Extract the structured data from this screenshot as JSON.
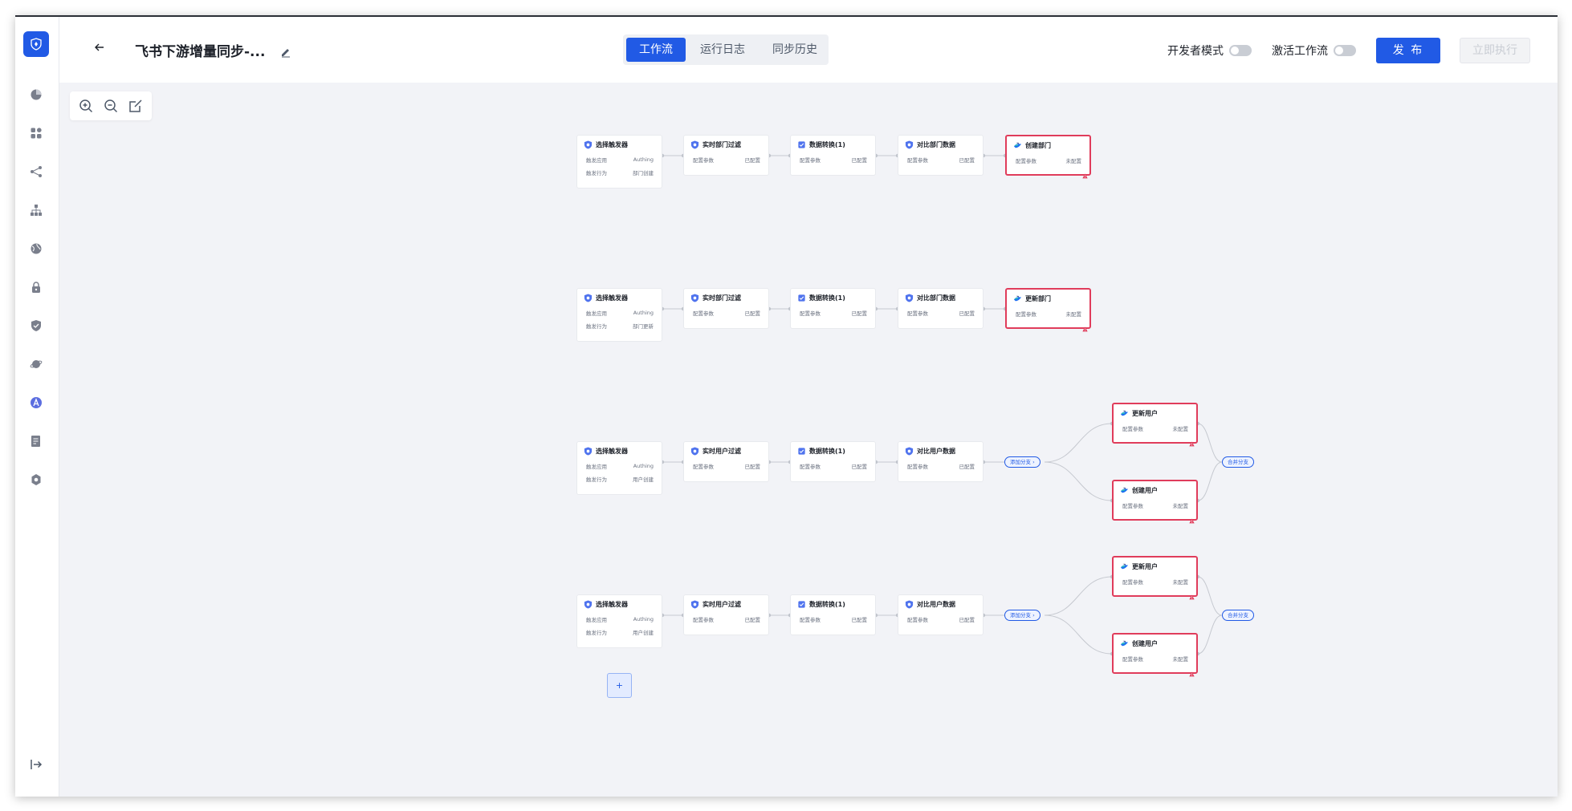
{
  "header": {
    "title": "飞书下游增量同步-...",
    "tabs": [
      {
        "label": "工作流",
        "active": true
      },
      {
        "label": "运行日志",
        "active": false
      },
      {
        "label": "同步历史",
        "active": false
      }
    ],
    "dev_mode_label": "开发者模式",
    "dev_mode_on": false,
    "activate_label": "激活工作流",
    "activate_on": false,
    "publish_label": "发 布",
    "run_label": "立即执行"
  },
  "sidebar": {
    "icons": [
      "dashboard-icon",
      "apps-icon",
      "share-icon",
      "org-icon",
      "globe-icon",
      "lock-icon",
      "shield-check-icon",
      "planet-icon",
      "font-a-icon",
      "document-icon",
      "settings-icon"
    ],
    "collapse_icon": "collapse-sidebar-icon"
  },
  "canvas": {
    "zoom_tools": [
      "zoom-in-icon",
      "zoom-out-icon",
      "fit-view-icon"
    ],
    "rows": [
      {
        "nodes": [
          {
            "title": "选择触发器",
            "icon": "shield-icon",
            "rows": [
              [
                "触发应用",
                "Authing"
              ],
              [
                "触发行为",
                "部门创建"
              ]
            ],
            "error": false
          },
          {
            "title": "实时部门过滤",
            "icon": "shield-icon",
            "rows": [
              [
                "配置参数",
                "已配置"
              ]
            ],
            "error": false
          },
          {
            "title": "数据转换(1)",
            "icon": "transform-icon",
            "rows": [
              [
                "配置参数",
                "已配置"
              ]
            ],
            "error": false
          },
          {
            "title": "对比部门数据",
            "icon": "shield-icon",
            "rows": [
              [
                "配置参数",
                "已配置"
              ]
            ],
            "error": false
          },
          {
            "title": "创建部门",
            "icon": "feishu-icon",
            "rows": [
              [
                "配置参数",
                "未配置"
              ]
            ],
            "error": true
          }
        ]
      },
      {
        "nodes": [
          {
            "title": "选择触发器",
            "icon": "shield-icon",
            "rows": [
              [
                "触发应用",
                "Authing"
              ],
              [
                "触发行为",
                "部门更新"
              ]
            ],
            "error": false
          },
          {
            "title": "实时部门过滤",
            "icon": "shield-icon",
            "rows": [
              [
                "配置参数",
                "已配置"
              ]
            ],
            "error": false
          },
          {
            "title": "数据转换(1)",
            "icon": "transform-icon",
            "rows": [
              [
                "配置参数",
                "已配置"
              ]
            ],
            "error": false
          },
          {
            "title": "对比部门数据",
            "icon": "shield-icon",
            "rows": [
              [
                "配置参数",
                "已配置"
              ]
            ],
            "error": false
          },
          {
            "title": "更新部门",
            "icon": "feishu-icon",
            "rows": [
              [
                "配置参数",
                "未配置"
              ]
            ],
            "error": true
          }
        ]
      },
      {
        "nodes": [
          {
            "title": "选择触发器",
            "icon": "shield-icon",
            "rows": [
              [
                "触发应用",
                "Authing"
              ],
              [
                "触发行为",
                "用户创建"
              ]
            ],
            "error": false
          },
          {
            "title": "实时用户过滤",
            "icon": "shield-icon",
            "rows": [
              [
                "配置参数",
                "已配置"
              ]
            ],
            "error": false
          },
          {
            "title": "数据转换(1)",
            "icon": "transform-icon",
            "rows": [
              [
                "配置参数",
                "已配置"
              ]
            ],
            "error": false
          },
          {
            "title": "对比用户数据",
            "icon": "shield-icon",
            "rows": [
              [
                "配置参数",
                "已配置"
              ]
            ],
            "error": false
          }
        ],
        "branch_label": "添加分支 ›",
        "branch_nodes": [
          {
            "title": "更新用户",
            "icon": "feishu-icon",
            "rows": [
              [
                "配置参数",
                "未配置"
              ]
            ],
            "error": true
          },
          {
            "title": "创建用户",
            "icon": "feishu-icon",
            "rows": [
              [
                "配置参数",
                "未配置"
              ]
            ],
            "error": true
          }
        ],
        "merge_label": "合并分支"
      },
      {
        "nodes": [
          {
            "title": "选择触发器",
            "icon": "shield-icon",
            "rows": [
              [
                "触发应用",
                "Authing"
              ],
              [
                "触发行为",
                "用户创建"
              ]
            ],
            "error": false
          },
          {
            "title": "实时用户过滤",
            "icon": "shield-icon",
            "rows": [
              [
                "配置参数",
                "已配置"
              ]
            ],
            "error": false
          },
          {
            "title": "数据转换(1)",
            "icon": "transform-icon",
            "rows": [
              [
                "配置参数",
                "已配置"
              ]
            ],
            "error": false
          },
          {
            "title": "对比用户数据",
            "icon": "shield-icon",
            "rows": [
              [
                "配置参数",
                "已配置"
              ]
            ],
            "error": false
          }
        ],
        "branch_label": "添加分支 ›",
        "branch_nodes": [
          {
            "title": "更新用户",
            "icon": "feishu-icon",
            "rows": [
              [
                "配置参数",
                "未配置"
              ]
            ],
            "error": true
          },
          {
            "title": "创建用户",
            "icon": "feishu-icon",
            "rows": [
              [
                "配置参数",
                "未配置"
              ]
            ],
            "error": true
          }
        ],
        "merge_label": "合并分支"
      }
    ],
    "add_label": "+"
  },
  "colors": {
    "accent": "#215ae5",
    "error_border": "#e03c5b",
    "canvas_bg": "#f2f3f7"
  }
}
